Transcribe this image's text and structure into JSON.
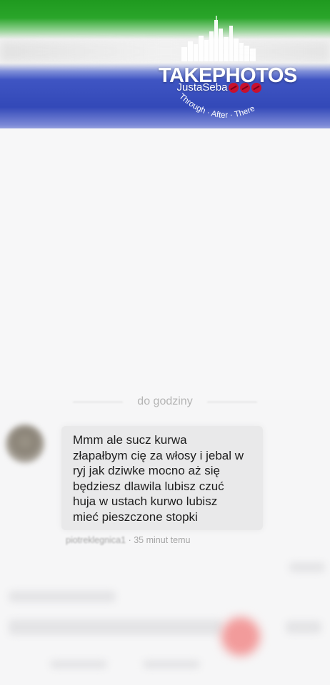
{
  "watermark": {
    "title": "TAKEPHOTOS",
    "name": "JustaSeba",
    "tagline": "Through · After · There",
    "kiss_icon": "kiss-lips-icon",
    "kiss_color": "#c8102e"
  },
  "chat": {
    "date_divider": "do godziny",
    "message": {
      "text": "Mmm ale sucz kurwa\nzłapałbym cię za włosy i jebal w\nryj jak dziwke mocno aż się\nbędziesz dlawila lubisz czuć\nhuja w ustach kurwo lubisz\nmieć pieszczone stopki",
      "author": "piotreklegnica1",
      "time_separator": "·",
      "time": "35 minut temu"
    }
  },
  "colors": {
    "banner_green": "#1f9a1f",
    "banner_blue": "#3349b8",
    "bubble_bg": "#e9e9ea",
    "background": "#f6f6f7"
  }
}
